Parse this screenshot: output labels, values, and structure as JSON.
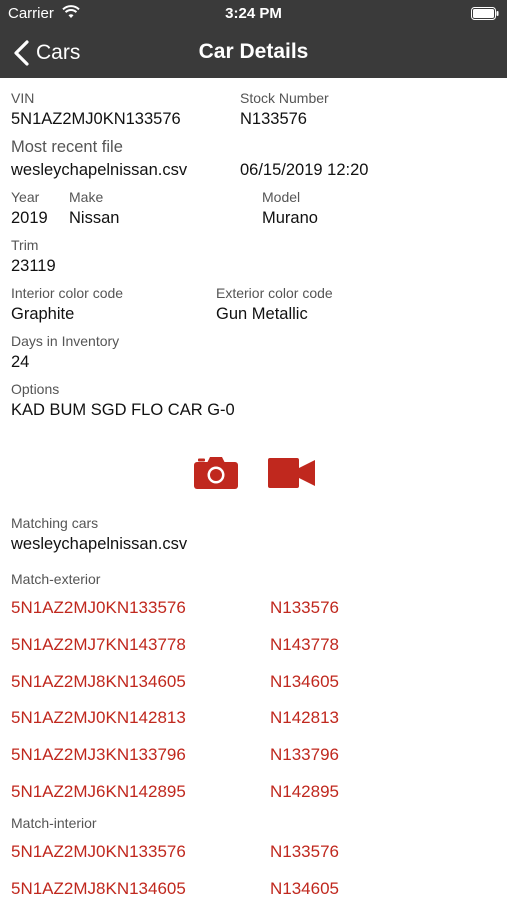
{
  "status_bar": {
    "carrier": "Carrier",
    "time": "3:24 PM"
  },
  "nav": {
    "back_label": "Cars",
    "title": "Car Details"
  },
  "details": {
    "vin_label": "VIN",
    "vin": "5N1AZ2MJ0KN133576",
    "stock_label": "Stock Number",
    "stock": "N133576",
    "recent_file_label": "Most recent file",
    "recent_file": "wesleychapelnissan.csv",
    "recent_file_date": "06/15/2019 12:20",
    "year_label": "Year",
    "year": "2019",
    "make_label": "Make",
    "make": "Nissan",
    "model_label": "Model",
    "model": "Murano",
    "trim_label": "Trim",
    "trim": "23119",
    "interior_label": "Interior color code",
    "interior": "Graphite",
    "exterior_label": "Exterior color code",
    "exterior": "Gun Metallic",
    "days_label": "Days in Inventory",
    "days": "24",
    "options_label": "Options",
    "options": "KAD BUM SGD FLO CAR G-0"
  },
  "actions": {
    "camera_icon": "camera-icon",
    "video_icon": "video-camera-icon"
  },
  "matching": {
    "label": "Matching cars",
    "file": "wesleychapelnissan.csv",
    "exterior_label": "Match-exterior",
    "exterior": [
      {
        "vin": "5N1AZ2MJ0KN133576",
        "stock": "N133576"
      },
      {
        "vin": "5N1AZ2MJ7KN143778",
        "stock": "N143778"
      },
      {
        "vin": "5N1AZ2MJ8KN134605",
        "stock": "N134605"
      },
      {
        "vin": "5N1AZ2MJ0KN142813",
        "stock": "N142813"
      },
      {
        "vin": "5N1AZ2MJ3KN133796",
        "stock": "N133796"
      },
      {
        "vin": "5N1AZ2MJ6KN142895",
        "stock": "N142895"
      }
    ],
    "interior_label": "Match-interior",
    "interior": [
      {
        "vin": "5N1AZ2MJ0KN133576",
        "stock": "N133576"
      },
      {
        "vin": "5N1AZ2MJ8KN134605",
        "stock": "N134605"
      }
    ]
  },
  "colors": {
    "bar": "#3a3a3a",
    "accent": "#c0281e",
    "label": "#555555",
    "text": "#111111"
  }
}
